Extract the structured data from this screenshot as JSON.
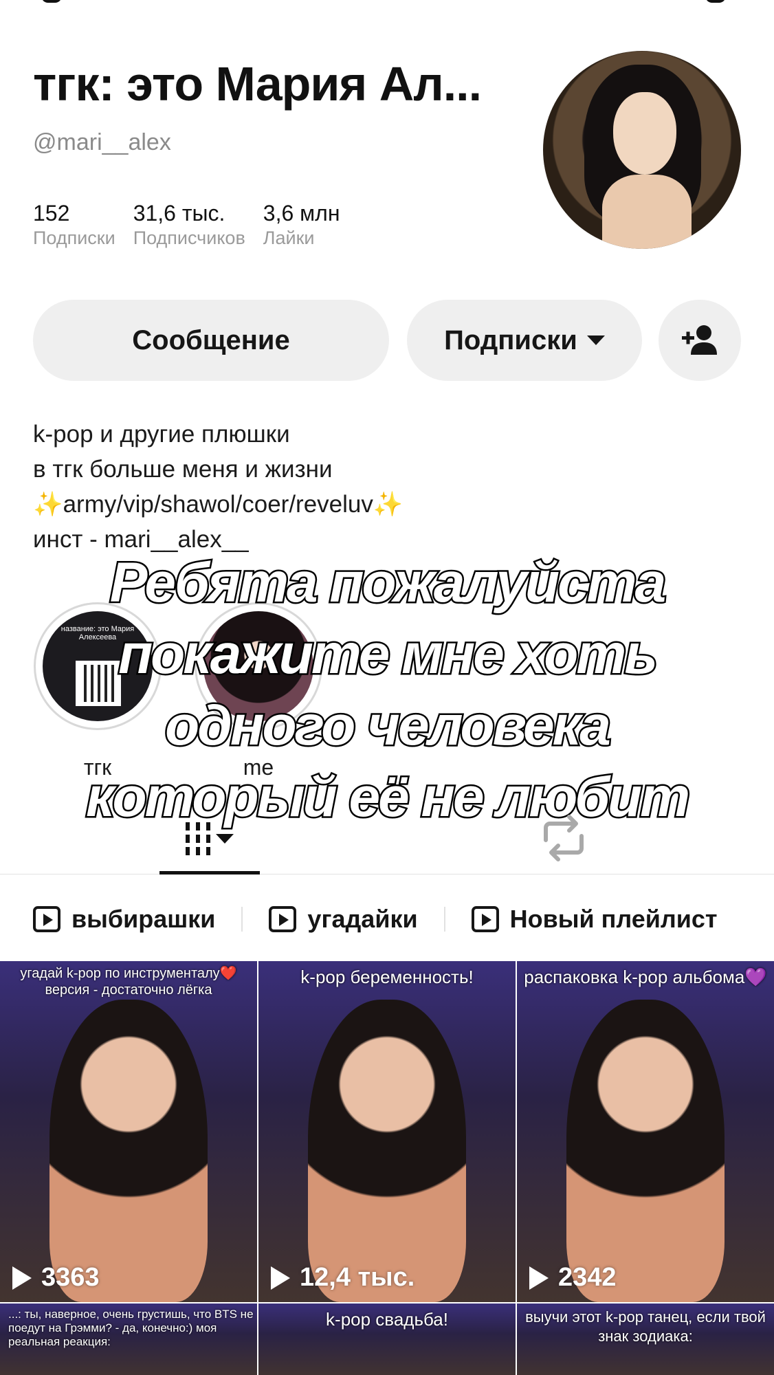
{
  "profile": {
    "display_name": "тгк: это Мария Ал...",
    "handle": "@mari__alex",
    "stats": [
      {
        "value": "152",
        "label": "Подписки"
      },
      {
        "value": "31,6 тыс.",
        "label": "Подписчиков"
      },
      {
        "value": "3,6 млн",
        "label": "Лайки"
      }
    ]
  },
  "actions": {
    "message_label": "Сообщение",
    "following_label": "Подписки",
    "add_friend_icon": "person-plus-icon"
  },
  "bio": {
    "line1": "k-pop и другие плюшки",
    "line2": "в тгк больше меня и жизни",
    "line3_sparkle": "✨",
    "line3_text": "army/vip/shawol/coer/reveluv",
    "line4": "инст - mari__alex__"
  },
  "highlights": [
    {
      "label": "тгк",
      "cover_caption": "название: это Мария Алексеева"
    },
    {
      "label": "me"
    }
  ],
  "overlay_text": [
    "Ребята пожалуйста",
    "покажите мне хоть",
    "одного человека",
    "который её не любит"
  ],
  "tabs": {
    "videos_icon": "grid-icon",
    "reposts_icon": "repost-icon"
  },
  "playlists": [
    {
      "label": "выбирашки"
    },
    {
      "label": "угадайки"
    },
    {
      "label": "Новый плейлист"
    }
  ],
  "videos": [
    {
      "caption": "угадай k-pop по инструменталу❤️ версия - достаточно лёгка",
      "views": "3363"
    },
    {
      "caption": "k-pop беременность!",
      "views": "12,4 тыс."
    },
    {
      "caption": "распаковка k-pop альбома💜",
      "views": "2342"
    },
    {
      "caption": "...: ты, наверное, очень грустишь, что BTS не поедут на Грэмми? - да, конечно:) моя реальная реакция:",
      "views": ""
    },
    {
      "caption": "k-pop свадьба!",
      "views": ""
    },
    {
      "caption": "выучи этот k-pop танец, если твой знак зодиака:",
      "views": ""
    }
  ],
  "colors": {
    "button_bg": "#efefef",
    "muted_text": "#8a8a8a",
    "sparkle": "#f2c12e"
  }
}
